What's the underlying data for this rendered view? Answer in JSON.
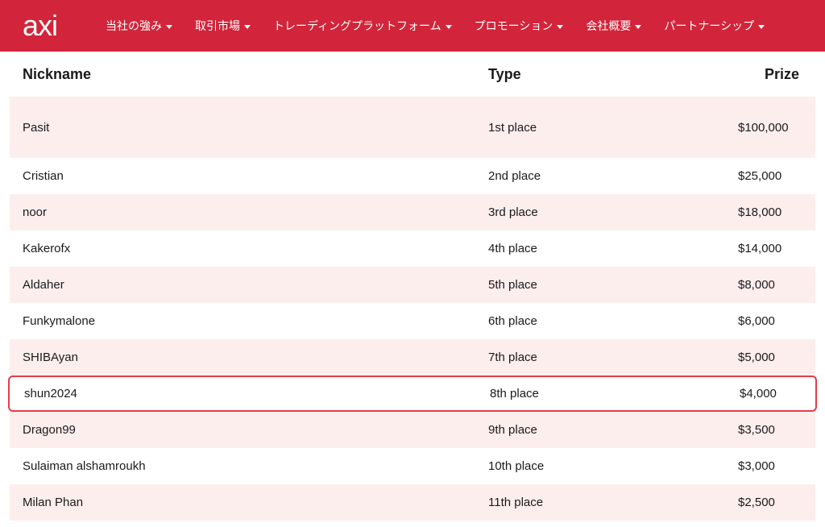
{
  "header": {
    "logo_text": "axi",
    "nav_items": [
      "当社の強み",
      "取引市場",
      "トレーディングプラットフォーム",
      "プロモーション",
      "会社概要",
      "パートナーシップ"
    ]
  },
  "table": {
    "headers": {
      "nickname": "Nickname",
      "type": "Type",
      "prize": "Prize"
    },
    "rows": [
      {
        "nickname": "Pasit",
        "type": "1st place",
        "prize": "$100,000",
        "highlighted": false
      },
      {
        "nickname": "Cristian",
        "type": "2nd place",
        "prize": "$25,000",
        "highlighted": false
      },
      {
        "nickname": "noor",
        "type": "3rd place",
        "prize": "$18,000",
        "highlighted": false
      },
      {
        "nickname": "Kakerofx",
        "type": "4th place",
        "prize": "$14,000",
        "highlighted": false
      },
      {
        "nickname": "Aldaher",
        "type": "5th place",
        "prize": "$8,000",
        "highlighted": false
      },
      {
        "nickname": "Funkymalone",
        "type": "6th place",
        "prize": "$6,000",
        "highlighted": false
      },
      {
        "nickname": "SHIBAyan",
        "type": "7th place",
        "prize": "$5,000",
        "highlighted": false
      },
      {
        "nickname": "shun2024",
        "type": "8th place",
        "prize": "$4,000",
        "highlighted": true
      },
      {
        "nickname": "Dragon99",
        "type": "9th place",
        "prize": "$3,500",
        "highlighted": false
      },
      {
        "nickname": "Sulaiman alshamroukh",
        "type": "10th place",
        "prize": "$3,000",
        "highlighted": false
      },
      {
        "nickname": "Milan Phan",
        "type": "11th place",
        "prize": "$2,500",
        "highlighted": false
      }
    ]
  }
}
